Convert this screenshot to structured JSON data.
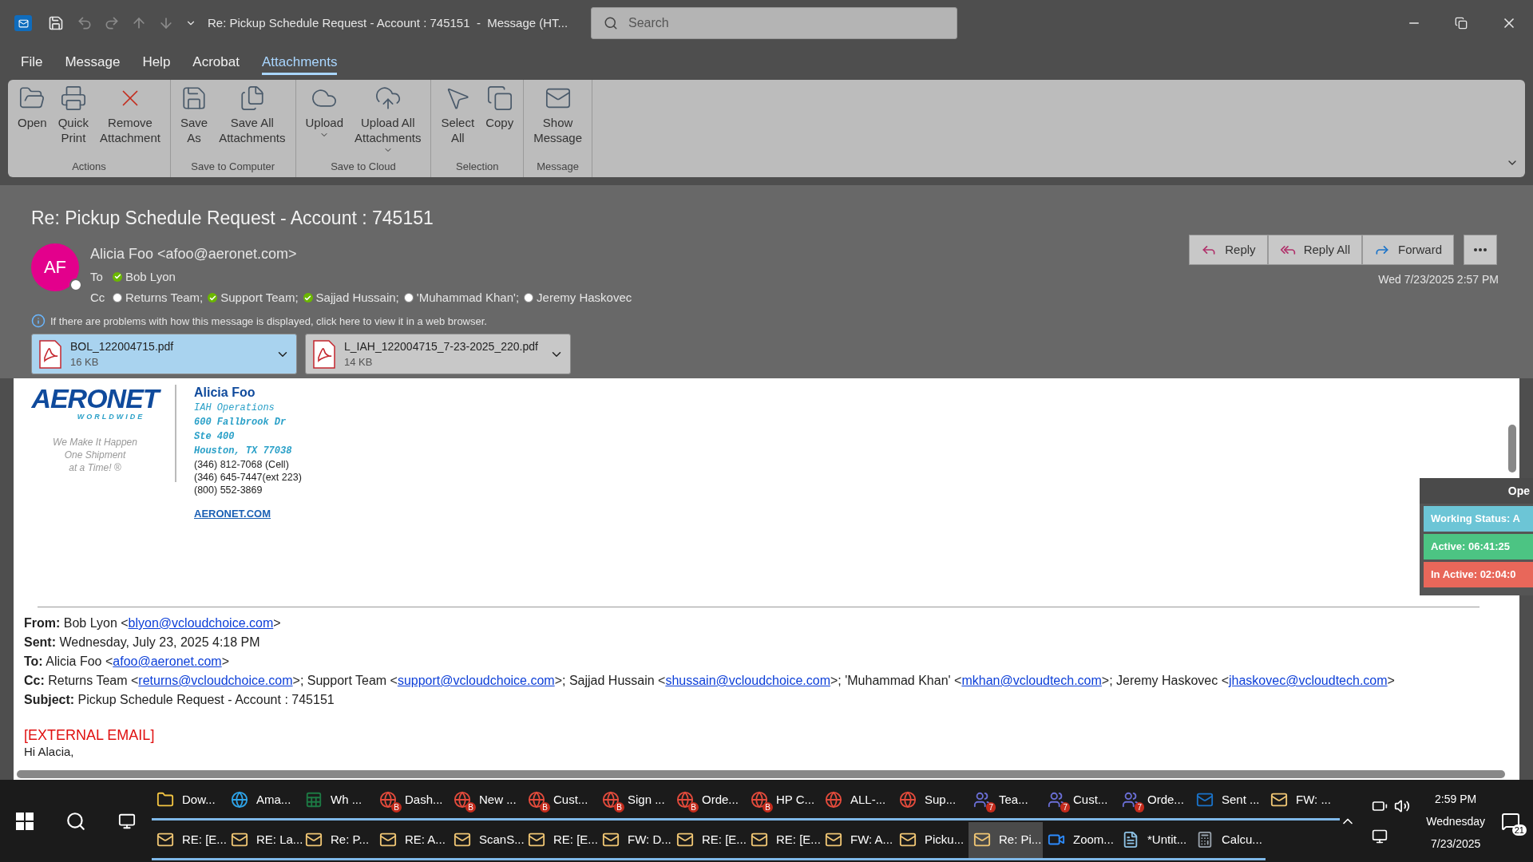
{
  "window": {
    "title": "Re: Pickup Schedule Request - Account : 745151  -  Message (HT...",
    "search_placeholder": "Search"
  },
  "menu_tabs": [
    {
      "label": "File",
      "selected": false
    },
    {
      "label": "Message",
      "selected": false
    },
    {
      "label": "Help",
      "selected": false
    },
    {
      "label": "Acrobat",
      "selected": false
    },
    {
      "label": "Attachments",
      "selected": true
    }
  ],
  "ribbon": [
    {
      "label": "Actions",
      "buttons": [
        {
          "lines": [
            "Open"
          ],
          "dropdown": false
        },
        {
          "lines": [
            "Quick",
            "Print"
          ],
          "dropdown": false
        },
        {
          "lines": [
            "Remove",
            "Attachment"
          ],
          "dropdown": false
        }
      ]
    },
    {
      "label": "Save to Computer",
      "buttons": [
        {
          "lines": [
            "Save",
            "As"
          ],
          "dropdown": false
        },
        {
          "lines": [
            "Save All",
            "Attachments"
          ],
          "dropdown": false
        }
      ]
    },
    {
      "label": "Save to Cloud",
      "buttons": [
        {
          "lines": [
            "Upload"
          ],
          "dropdown": true
        },
        {
          "lines": [
            "Upload All",
            "Attachments"
          ],
          "dropdown": true
        }
      ]
    },
    {
      "label": "Selection",
      "buttons": [
        {
          "lines": [
            "Select",
            "All"
          ],
          "dropdown": false
        },
        {
          "lines": [
            "Copy"
          ],
          "dropdown": false
        }
      ]
    },
    {
      "label": "Message",
      "buttons": [
        {
          "lines": [
            "Show",
            "Message"
          ],
          "dropdown": false
        }
      ]
    }
  ],
  "message": {
    "subject": "Re: Pickup Schedule Request - Account : 745151",
    "avatar": "AF",
    "sender": "Alicia Foo <afoo@aeronet.com>",
    "to_label": "To",
    "to": [
      {
        "name": "Bob Lyon",
        "available": true
      }
    ],
    "cc_label": "Cc",
    "cc": [
      {
        "name": "Returns Team;",
        "available": false
      },
      {
        "name": "Support Team;",
        "available": true
      },
      {
        "name": "Sajjad Hussain;",
        "available": true
      },
      {
        "name": "'Muhammad Khan';",
        "available": false
      },
      {
        "name": "Jeremy Haskovec",
        "available": false
      }
    ],
    "date": "Wed 7/23/2025 2:57 PM",
    "info": "If there are problems with how this message is displayed, click here to view it in a web browser.",
    "actions": [
      "Reply",
      "Reply All",
      "Forward"
    ],
    "attachments": [
      {
        "name": "BOL_122004715.pdf",
        "size": "16 KB",
        "selected": true
      },
      {
        "name": "L_IAH_122004715_7-23-2025_220.pdf",
        "size": "14 KB",
        "selected": false
      }
    ]
  },
  "signature": {
    "logo": "AERONET",
    "logo_sub": "WORLDWIDE",
    "tagline": [
      "We Make It Happen",
      "One Shipment",
      "at a Time! ®"
    ],
    "name": "Alicia Foo",
    "title": "IAH Operations",
    "address": [
      "600 Fallbrook Dr",
      "Ste 400",
      "Houston, TX 77038"
    ],
    "phones": [
      "(346) 812-7068 (Cell)",
      "(346) 645-7447(ext 223)",
      "(800) 552-3869"
    ],
    "link": "AERONET.COM"
  },
  "quoted": [
    {
      "label": "From:",
      "parts": [
        {
          "text": " Bob Lyon <"
        },
        {
          "link": "blyon@vcloudchoice.com"
        },
        {
          "text": ">"
        }
      ]
    },
    {
      "label": "Sent:",
      "parts": [
        {
          "text": " Wednesday, July 23, 2025 4:18 PM"
        }
      ]
    },
    {
      "label": "To:",
      "parts": [
        {
          "text": " Alicia Foo <"
        },
        {
          "link": "afoo@aeronet.com"
        },
        {
          "text": ">"
        }
      ]
    },
    {
      "label": "Cc:",
      "parts": [
        {
          "text": " Returns Team <"
        },
        {
          "link": "returns@vcloudchoice.com"
        },
        {
          "text": ">; Support Team <"
        },
        {
          "link": "support@vcloudchoice.com"
        },
        {
          "text": ">; Sajjad Hussain <"
        },
        {
          "link": "shussain@vcloudchoice.com"
        },
        {
          "text": ">; 'Muhammad Khan' <"
        },
        {
          "link": "mkhan@vcloudtech.com"
        },
        {
          "text": ">; Jeremy Haskovec <"
        },
        {
          "link": "jhaskovec@vcloudtech.com"
        },
        {
          "text": ">"
        }
      ]
    },
    {
      "label": "Subject:",
      "parts": [
        {
          "text": " Pickup Schedule Request - Account : 745151"
        }
      ]
    }
  ],
  "external_tag": "[EXTERNAL EMAIL]",
  "greeting": "Hi Alacia,",
  "widget": {
    "header": "Ope",
    "rows": [
      {
        "text": "Working Status: A",
        "color": "#6cc5d6"
      },
      {
        "text": "Active: 06:41:25",
        "color": "#4cc483"
      },
      {
        "text": "In Active: 02:04:0",
        "color": "#e8675a"
      }
    ]
  },
  "taskbar": {
    "rows": [
      [
        {
          "kind": "explorer",
          "label": "Dow..."
        },
        {
          "kind": "edge",
          "label": "Ama..."
        },
        {
          "kind": "excel",
          "label": "Wh ..."
        },
        {
          "kind": "chrome",
          "label": "Dash...",
          "badge": "B"
        },
        {
          "kind": "chrome",
          "label": "New ...",
          "badge": "B"
        },
        {
          "kind": "chrome",
          "label": "Cust...",
          "badge": "B"
        },
        {
          "kind": "chrome",
          "label": "Sign ...",
          "badge": "B"
        },
        {
          "kind": "chrome",
          "label": "Orde...",
          "badge": "B"
        },
        {
          "kind": "chrome",
          "label": "HP C...",
          "badge": "B"
        },
        {
          "kind": "chrome",
          "label": "ALL-..."
        },
        {
          "kind": "chrome",
          "label": "Sup..."
        },
        {
          "kind": "teams",
          "label": "Tea...",
          "badge": "7"
        },
        {
          "kind": "teams",
          "label": "Cust...",
          "badge": "7"
        },
        {
          "kind": "teams",
          "label": "Orde...",
          "badge": "7"
        },
        {
          "kind": "outlook",
          "label": "Sent ..."
        },
        {
          "kind": "mail",
          "label": "FW: ..."
        }
      ],
      [
        {
          "kind": "mail",
          "label": "RE: [E..."
        },
        {
          "kind": "mail",
          "label": "RE: La..."
        },
        {
          "kind": "mail",
          "label": "Re: P..."
        },
        {
          "kind": "mail",
          "label": "RE: A..."
        },
        {
          "kind": "mail",
          "label": "ScanS..."
        },
        {
          "kind": "mail",
          "label": "RE: [E..."
        },
        {
          "kind": "mail",
          "label": "FW: D..."
        },
        {
          "kind": "mail",
          "label": "RE: [E..."
        },
        {
          "kind": "mail",
          "label": "RE: [E..."
        },
        {
          "kind": "mail",
          "label": "FW: A..."
        },
        {
          "kind": "mail",
          "label": "Picku..."
        },
        {
          "kind": "mail",
          "label": "Re: Pi...",
          "selected": true
        },
        {
          "kind": "zoom",
          "label": "Zoom..."
        },
        {
          "kind": "notepad",
          "label": "*Untit..."
        },
        {
          "kind": "calculator",
          "label": "Calcu..."
        }
      ]
    ],
    "time": "2:59 PM",
    "day": "Wednesday",
    "date": "7/23/2025",
    "notifications": "21"
  }
}
